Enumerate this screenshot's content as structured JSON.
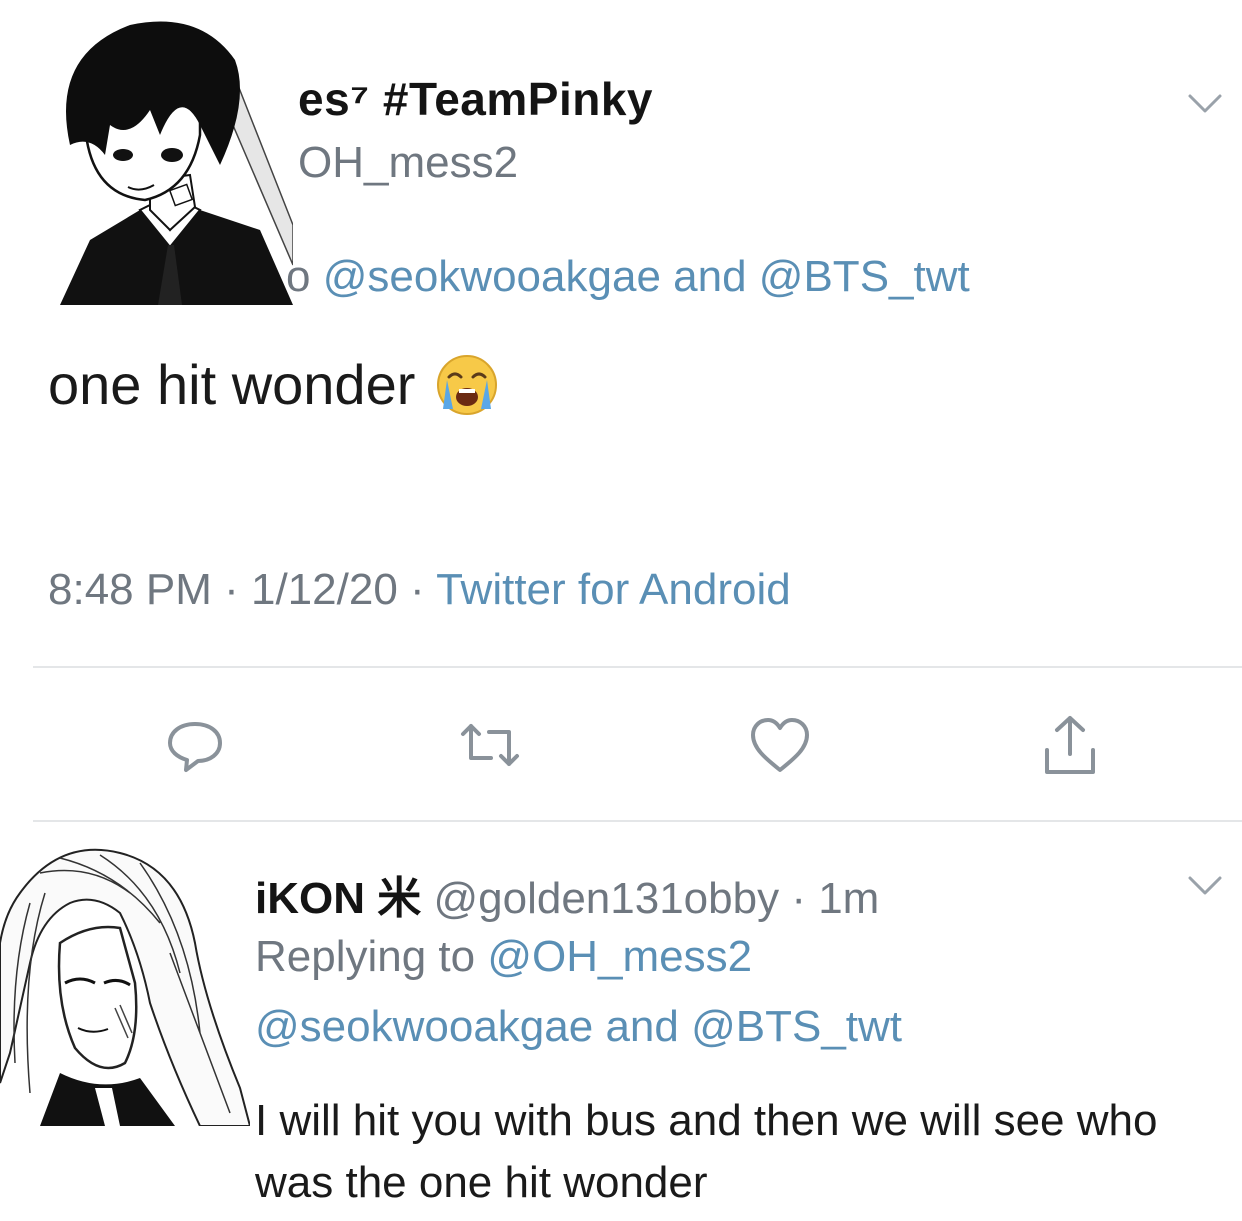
{
  "tweet": {
    "display_name": "es⁷ #TeamPinky",
    "handle": "OH_mess2",
    "replying_prefix": "o ",
    "mention_1": "@seokwooakgae",
    "mention_joiner": " and ",
    "mention_2": "@BTS_twt",
    "text": "one hit wonder",
    "emoji": "loudly-crying-face-emoji",
    "time": "8:48 PM",
    "separator": " · ",
    "date": "1/12/20",
    "source": "Twitter for Android"
  },
  "actions": {
    "reply_icon": "reply-icon",
    "retweet_icon": "retweet-icon",
    "like_icon": "heart-icon",
    "share_icon": "share-icon"
  },
  "reply": {
    "display_name": "iKON 米",
    "handle": "@golden131obby",
    "separator": " · ",
    "age": "1m",
    "replying_to_label": "Replying to ",
    "replying_to_handle": "@OH_mess2",
    "mention_1": "@seokwooakgae",
    "mention_joiner": " and ",
    "mention_2": "@BTS_twt",
    "text": "I will hit you with bus and then we will see who was the one hit wonder"
  },
  "colors": {
    "link": "#5a8fb5",
    "muted": "#6f7780",
    "text": "#1a1a1a",
    "divider": "#e4e6e8"
  }
}
